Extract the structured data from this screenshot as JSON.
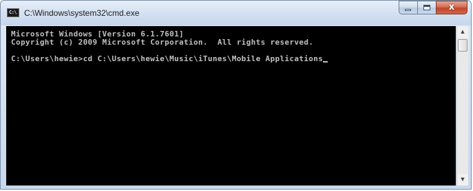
{
  "window": {
    "title": "C:\\Windows\\system32\\cmd.exe",
    "icon": "cmd-icon",
    "icon_text": "C:\\",
    "controls": {
      "minimize": "minimize-icon",
      "maximize": "maximize-icon",
      "close": "close-icon",
      "close_glyph": "x"
    }
  },
  "console": {
    "lines": [
      "Microsoft Windows [Version 6.1.7601]",
      "Copyright (c) 2009 Microsoft Corporation.  All rights reserved.",
      "",
      "C:\\Users\\hewie>cd C:\\Users\\hewie\\Music\\iTunes\\Mobile Applications"
    ],
    "background": "#000000",
    "foreground": "#c0c0c0"
  },
  "scrollbar": {
    "up_arrow": "▲",
    "down_arrow": "▼"
  }
}
